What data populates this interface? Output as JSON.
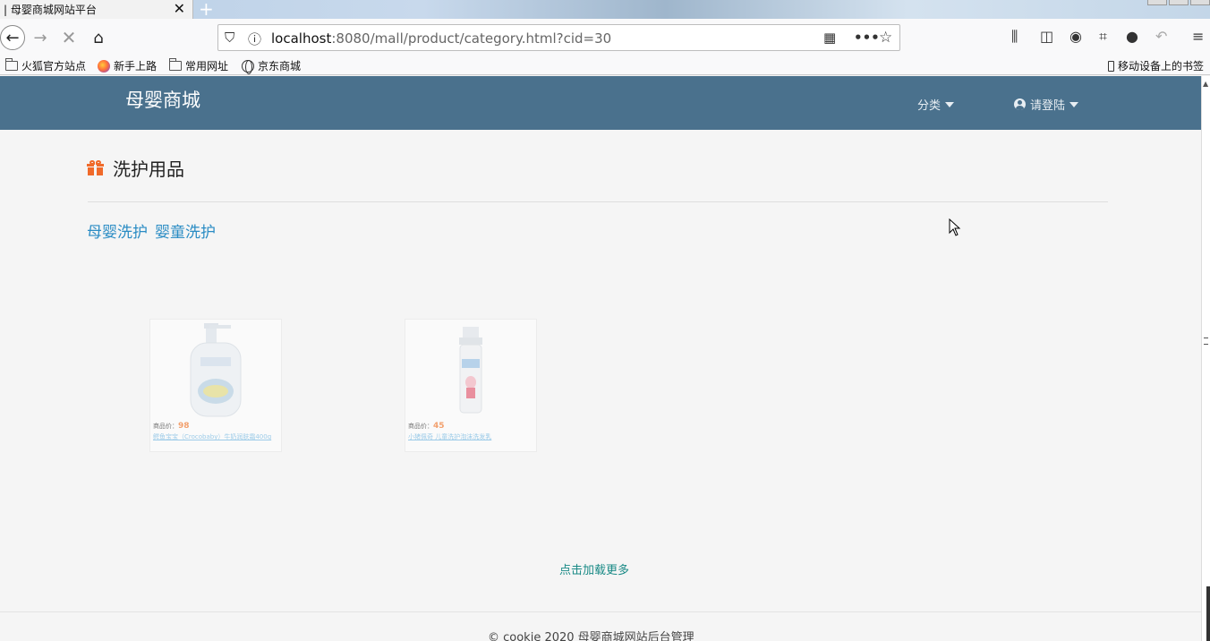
{
  "browser": {
    "tab_title": "| 母婴商城网站平台",
    "tab_close": "✕",
    "new_tab": "+",
    "url_host": "localhost",
    "url_rest": ":8080/mall/product/category.html?cid=30",
    "bookmarks": [
      "火狐官方站点",
      "新手上路",
      "常用网址",
      "京东商城"
    ],
    "mobile_bookmarks": "移动设备上的书签"
  },
  "site": {
    "brand": "母婴商城",
    "menu_category": "分类",
    "menu_login": "请登陆"
  },
  "category": {
    "title": "洗护用品",
    "subcategories": [
      "母婴洗护",
      "婴童洗护"
    ]
  },
  "products": [
    {
      "price_label": "商品价：",
      "price": "98",
      "name": "鳄鱼宝宝（Crocobaby）牛奶润肤霜400g"
    },
    {
      "price_label": "商品价：",
      "price": "45",
      "name": "小猪佩奇 儿童洗护泡沫洗发乳"
    }
  ],
  "load_more": "点击加载更多",
  "footer": "© cookie 2020   母婴商城网站后台管理",
  "colors": {
    "header": "#4a718d",
    "link": "#2a8cc4",
    "price": "#f2a06e",
    "load_more": "#1a8a86"
  }
}
